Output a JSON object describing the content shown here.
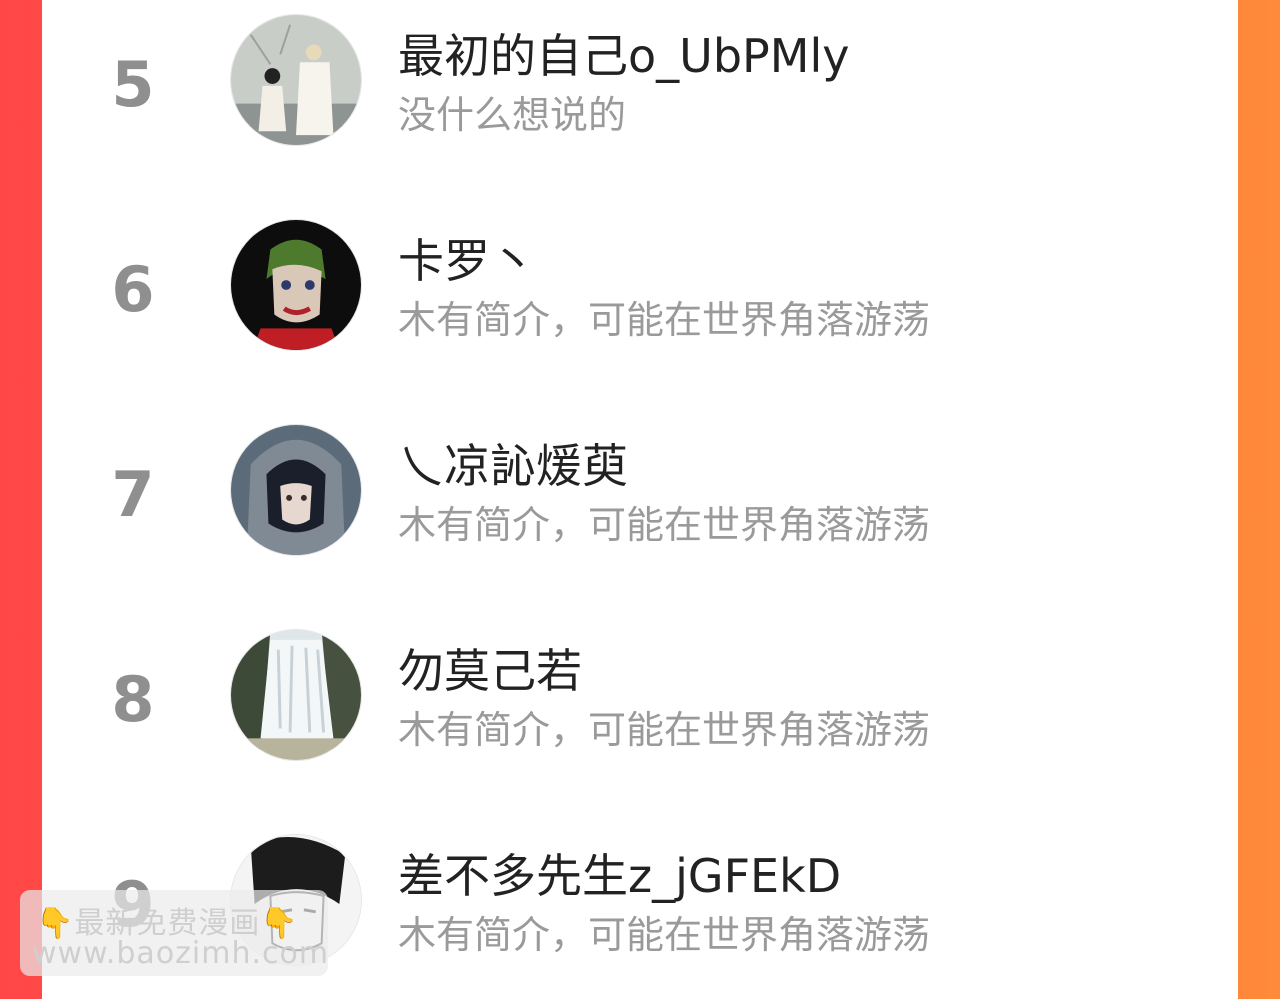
{
  "ranking": [
    {
      "rank": "5",
      "name": "最初的自己o_UbPMly",
      "bio": "没什么想说的",
      "avatar_icon": "couple-illustration-avatar-icon"
    },
    {
      "rank": "6",
      "name": "卡罗丶",
      "bio": "木有简介，可能在世界角落游荡",
      "avatar_icon": "joker-avatar-icon"
    },
    {
      "rank": "7",
      "name": "乀凉訫煖萸",
      "bio": "木有简介，可能在世界角落游荡",
      "avatar_icon": "anime-hooded-boy-avatar-icon"
    },
    {
      "rank": "8",
      "name": "勿莫己若",
      "bio": "木有简介，可能在世界角落游荡",
      "avatar_icon": "waterfall-avatar-icon"
    },
    {
      "rank": "9",
      "name": "差不多先生z_jGFEkD",
      "bio": "木有简介，可能在世界角落游荡",
      "avatar_icon": "manga-face-avatar-icon"
    }
  ],
  "watermark": {
    "line1": "最新免费漫画",
    "line2": "www.baozimh.com",
    "icon": "pointing-down-hand-icon"
  },
  "colors": {
    "rank_text": "#8f8f8f",
    "name_text": "#222222",
    "bio_text": "#9a9a9a",
    "background_gradient_left": "#ff4747",
    "background_gradient_right": "#ff8a3a"
  }
}
